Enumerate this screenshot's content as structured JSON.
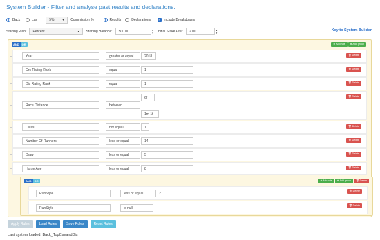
{
  "page": {
    "title": "System Builder - Filter and analyse past results and declarations."
  },
  "options": {
    "back_label": "Back",
    "lay_label": "Lay",
    "commission_value": "5%",
    "commission_label": "Commission %",
    "results_label": "Results",
    "declarations_label": "Declarations",
    "breakdowns_label": "Include Breakdowns",
    "back_selected": true,
    "results_selected": true,
    "breakdowns_checked": true
  },
  "staking": {
    "plan_label": "Staking Plan:",
    "plan_value": "Percent",
    "balance_label": "Starting Balance:",
    "balance_value": "500.00",
    "stake_label": "Initial Stake £/%:",
    "stake_value": "2.00",
    "key_link": "Key to System Builder"
  },
  "group": {
    "and_label": "AND",
    "or_label": "OR",
    "add_rule_label": "⊕ Add rule",
    "add_group_label": "⊕ Add group",
    "delete_label": "🗑 Delete"
  },
  "rules": [
    {
      "field": "Year",
      "operator": "greater or equal",
      "values": [
        "2018"
      ]
    },
    {
      "field": "Ors Rating Rank",
      "operator": "equal",
      "values": [
        "1"
      ]
    },
    {
      "field": "Dis Rating Rank",
      "operator": "equal",
      "values": [
        "1"
      ]
    },
    {
      "field": "Race Distance",
      "operator": "between",
      "values": [
        "6f",
        "1m 1f"
      ]
    },
    {
      "field": "Class",
      "operator": "not equal",
      "values": [
        "1"
      ]
    },
    {
      "field": "Number Of Runners",
      "operator": "less or equal",
      "values": [
        "14"
      ]
    },
    {
      "field": "Draw",
      "operator": "less or equal",
      "values": [
        "5"
      ]
    },
    {
      "field": "Horse Age",
      "operator": "less or equal",
      "values": [
        "8"
      ]
    }
  ],
  "subgroup": {
    "and_label": "AND",
    "or_label": "OR",
    "add_rule_label": "⊕ Add rule",
    "add_group_label": "⊕ Add group",
    "delete_label": "🗑 Delete",
    "rules": [
      {
        "field": "RunStyle",
        "operator": "less or equal",
        "values": [
          "2"
        ]
      },
      {
        "field": "RunStyle",
        "operator": "is null",
        "values": []
      }
    ]
  },
  "buttons": {
    "apply": "Apply Rules",
    "load": "Load Rules",
    "save": "Save Rules",
    "reset": "Reset Rules"
  },
  "status": {
    "last_loaded": "Last system loaded: Back_TopCseandDis"
  }
}
